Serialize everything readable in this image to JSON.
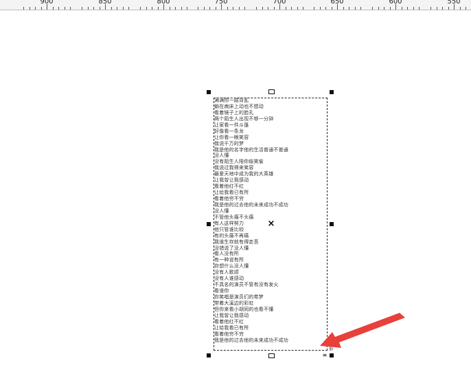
{
  "ruler": {
    "labels": [
      "900",
      "850",
      "800",
      "750",
      "700",
      "650",
      "600",
      "550"
    ]
  },
  "canvas": {
    "text_lines": [
      "满满你一路背乱",
      "躺在病床上动也不想动",
      "看着镜子上的脸孔",
      "两个陌生人出现不够一分钟",
      "让家看一件斗篷",
      "好像看一条龙",
      "让你看一眼笑容",
      "我说千万的梦",
      "我是他的名字他的生活普通不普通",
      "没人懂",
      "没有陌生人陪你偷笑偷",
      "我说过我得来笑容",
      "最爱天地中成为我的大英雄",
      "让我曾让我感动",
      "看着他红不红",
      "让给我看已有所",
      "看着他穷不穷",
      "我是他的过去他的未来成功不成功",
      "没人懂",
      "不管他头痛不头痛",
      "有人这样努力",
      "他只管谁比较",
      "有的头痛不再痛",
      "我谁生存就有得走吾",
      "没错说了没人懂",
      "看人没有所",
      "有一种说有所",
      "你想什么没人懂",
      "没有人歌颂",
      "没有人谁感动",
      "不具名的演员不管有没有发火",
      "看谁你",
      "你笑唱是演员们的希梦",
      "带着大溪边的彩虹",
      "但你来看小胡同的也看不懂",
      "让我曾让我感动",
      "看着他红不红",
      "让给我看已有所",
      "看着他穷不穷",
      "我是他的过去他的未来成功不成功"
    ],
    "center_mark": "×",
    "flow_tab_right": "⊪",
    "flow_tab_bottom": "≡"
  },
  "colors": {
    "arrow": "#e8403b",
    "frame": "#222222",
    "handle": "#111111"
  }
}
